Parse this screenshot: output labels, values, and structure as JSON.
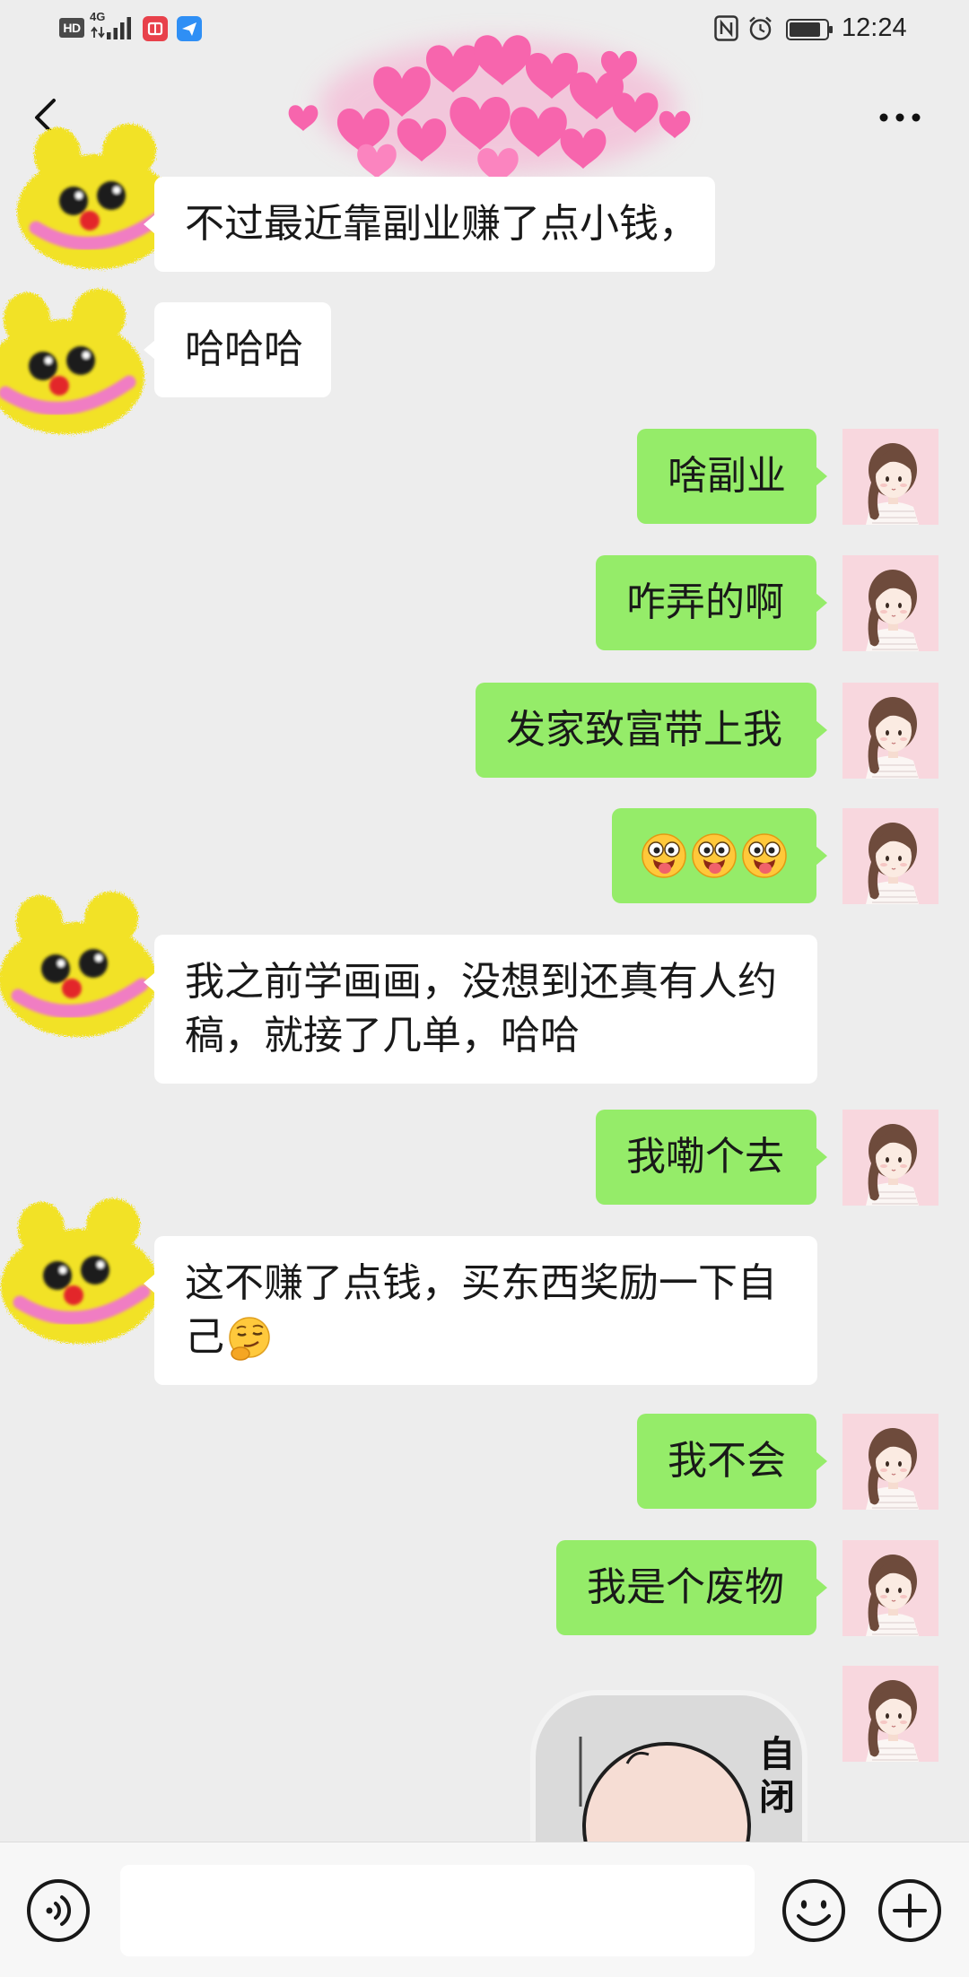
{
  "status_bar": {
    "hd_badge": "HD",
    "network": "4G",
    "time": "12:24",
    "battery_level": 0.85,
    "icons": [
      "signal-icon",
      "red-app-icon",
      "blue-app-icon",
      "nfc-icon",
      "alarm-icon",
      "battery-icon"
    ]
  },
  "header": {
    "back_icon": "chevron-left-icon",
    "more_icon": "more-icon"
  },
  "messages": [
    {
      "outgoing": false,
      "lines": [
        "不过最近靠副业赚了点小钱，"
      ]
    },
    {
      "outgoing": false,
      "lines": [
        "哈哈哈"
      ]
    },
    {
      "outgoing": true,
      "lines": [
        "啥副业"
      ]
    },
    {
      "outgoing": true,
      "lines": [
        "咋弄的啊"
      ]
    },
    {
      "outgoing": true,
      "lines": [
        "发家致富带上我"
      ]
    },
    {
      "outgoing": true,
      "emojis": [
        "tongue-out-emoji",
        "tongue-out-emoji",
        "tongue-out-emoji"
      ]
    },
    {
      "outgoing": false,
      "lines": [
        "我之前学画画，没想到还真有人约",
        "稿，就接了几单，哈哈"
      ]
    },
    {
      "outgoing": true,
      "lines": [
        "我嘞个去"
      ]
    },
    {
      "outgoing": false,
      "lines": [
        "这不赚了点钱，买东西奖励一下自",
        "己"
      ],
      "trailing_emoji": "smirk-emoji"
    },
    {
      "outgoing": true,
      "lines": [
        "我不会"
      ]
    },
    {
      "outgoing": true,
      "lines": [
        "我是个废物"
      ]
    },
    {
      "outgoing": true,
      "sticker": {
        "text": [
          "自",
          "闭"
        ]
      }
    }
  ],
  "input_bar": {
    "value": "",
    "voice_icon": "voice-icon",
    "emoji_icon": "emoji-icon",
    "plus_icon": "plus-icon"
  },
  "colors": {
    "background": "#ededed",
    "sent_bubble": "#95ec69",
    "received_bubble": "#ffffff",
    "text": "#191919",
    "redaction": "#f765ad"
  }
}
